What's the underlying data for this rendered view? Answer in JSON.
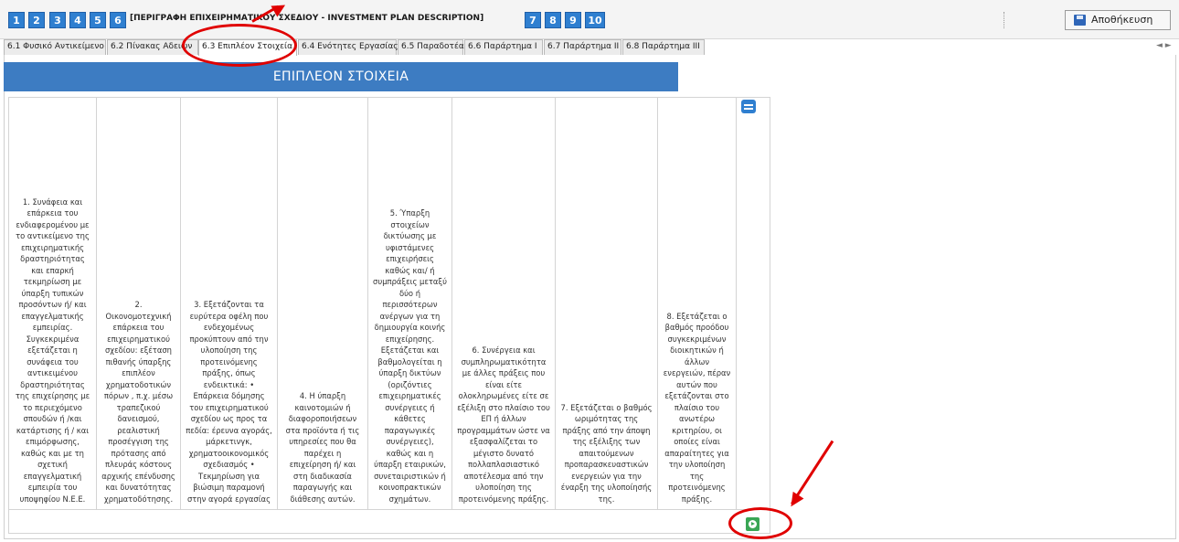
{
  "toolbar": {
    "steps": [
      "1",
      "2",
      "3",
      "4",
      "5",
      "6",
      "7",
      "8",
      "9",
      "10"
    ],
    "step6_title": "[ΠΕΡΙΓΡΑΦΗ ΕΠΙΧΕΙΡΗΜΑΤΙΚΟΥ ΣΧΕΔΙΟΥ - INVESTMENT PLAN DESCRIPTION]",
    "save_label": "Αποθήκευση"
  },
  "tabs": [
    "6.1 Φυσικό Αντικείμενο",
    "6.2 Πίνακας Αδειών",
    "6.3 Επιπλέον Στοιχεία",
    "6.4 Ενότητες Εργασίας",
    "6.5 Παραδοτέα",
    "6.6 Παράρτημα I",
    "6.7 Παράρτημα II",
    "6.8 Παράρτημα III"
  ],
  "tab_nav": "◄ ►",
  "active_tab_index": 2,
  "section": {
    "header": "ΕΠΙΠΛΕΟΝ ΣΤΟΙΧΕΙΑ"
  },
  "criteria": [
    "1. Συνάφεια και επάρκεια του ενδιαφερομένου με το αντικείμενο της επιχειρηματικής δραστηριότητας και επαρκή τεκμηρίωση με ύπαρξη τυπικών προσόντων ή/ και επαγγελματικής εμπειρίας. Συγκεκριμένα εξετάζεται η συνάφεια του αντικειμένου δραστηριότητας της επιχείρησης με το περιεχόμενο σπουδών ή /και κατάρτισης ή / και επιμόρφωσης, καθώς και με τη σχετική επαγγελματική εμπειρία του υποψηφίου Ν.Ε.Ε.",
    "2. Οικονομοτεχνική επάρκεια του επιχειρηματικού σχεδίου: εξέταση πιθανής ύπαρξης επιπλέον χρηματοδοτικών πόρων , π.χ. μέσω τραπεζικού δανεισμού, ρεαλιστική προσέγγιση της πρότασης από πλευράς κόστους αρχικής επένδυσης και δυνατότητας χρηματοδότησης.",
    "3. Εξετάζονται τα ευρύτερα οφέλη που ενδεχομένως προκύπτουν από την υλοποίηση της προτεινόμενης πράξης, όπως ενδεικτικά: • Επάρκεια δόμησης του επιχειρηματικού σχεδίου ως προς τα πεδία: έρευνα αγοράς, μάρκετινγκ, χρηματοοικονομικός σχεδιασμός • Τεκμηρίωση για βιώσιμη παραμονή στην αγορά εργασίας",
    "4. Η ύπαρξη καινοτομιών ή διαφοροποιήσεων στα προϊόντα ή τις υπηρεσίες που θα παρέχει η επιχείρηση ή/ και στη διαδικασία παραγωγής και διάθεσης αυτών.",
    "5. Ύπαρξη στοιχείων δικτύωσης με υφιστάμενες επιχειρήσεις καθώς και/ ή συμπράξεις μεταξύ δύο ή περισσότερων ανέργων για τη δημιουργία κοινής επιχείρησης. Εξετάζεται και βαθμολογείται η ύπαρξη δικτύων (οριζόντιες επιχειρηματικές συνέργειες ή κάθετες παραγωγικές συνέργειες), καθώς και η ύπαρξη εταιρικών, συνεταιριστικών ή κοινοπρακτικών σχημάτων.",
    "6. Συνέργεια και συμπληρωματικότητα με άλλες πράξεις που είναι είτε ολοκληρωμένες είτε σε εξέλιξη στο πλαίσιο του ΕΠ ή άλλων προγραμμάτων ώστε να εξασφαλίζεται το μέγιστο δυνατό πολλαπλασιαστικό αποτέλεσμα από την υλοποίηση της προτεινόμενης πράξης.",
    "7. Εξετάζεται ο βαθμός ωριμότητας της πράξης από την άποψη της εξέλιξης των απαιτούμενων προπαρασκευαστικών ενεργειών για την έναρξη της υλοποίησής της.",
    "8. Εξετάζεται ο βαθμός προόδου συγκεκριμένων διοικητικών ή άλλων ενεργειών, πέραν αυτών που εξετάζονται στο πλαίσιο του ανωτέρω κριτηρίου, οι οποίες είναι απαραίτητες για την υλοποίηση της προτεινόμενης πράξης."
  ],
  "colors": {
    "primary": "#2f7fd0",
    "header": "#3d7cc2",
    "add": "#3aa655",
    "annotation": "#e00000"
  },
  "icons": {
    "edit": "edit-row-icon",
    "add": "add-row-icon",
    "save": "floppy-disk-icon"
  }
}
